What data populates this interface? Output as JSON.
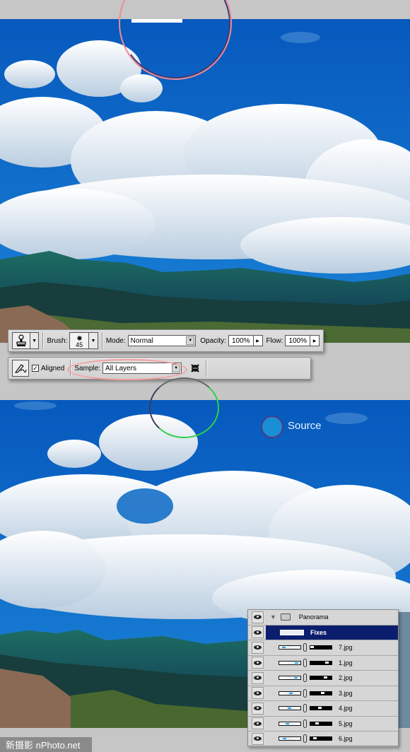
{
  "toolbar": {
    "tool_icon": "clone-stamp-icon",
    "brush_label": "Brush:",
    "brush_size": "45",
    "mode_label": "Mode:",
    "mode_value": "Normal",
    "opacity_label": "Opacity:",
    "opacity_value": "100%",
    "flow_label": "Flow:",
    "flow_value": "100%"
  },
  "toolbar2": {
    "aligned_label": "Aligned",
    "aligned_checked": "✓",
    "sample_label": "Sample:",
    "sample_value": "All Layers",
    "ignore_adjustment_icon": "ignore-adjustment-layers-icon"
  },
  "canvas": {
    "source_label": "Source",
    "colors": {
      "sky": "#0a63c4",
      "highlight_ellipse": "#f6a0a0",
      "source_marker": "#1a8fd6"
    }
  },
  "layers": {
    "group": "Panorama",
    "selected": "Fixes",
    "items": [
      {
        "name": "7.jpg",
        "thumb_pos": 0.15,
        "mask_pos": 0.05
      },
      {
        "name": "1.jpg",
        "thumb_pos": 0.85,
        "mask_pos": 0.85
      },
      {
        "name": "2.jpg",
        "thumb_pos": 0.8,
        "mask_pos": 0.75
      },
      {
        "name": "3.jpg",
        "thumb_pos": 0.55,
        "mask_pos": 0.6
      },
      {
        "name": "4.jpg",
        "thumb_pos": 0.45,
        "mask_pos": 0.45
      },
      {
        "name": "5.jpg",
        "thumb_pos": 0.35,
        "mask_pos": 0.3
      },
      {
        "name": "6.jpg",
        "thumb_pos": 0.2,
        "mask_pos": 0.2
      }
    ]
  },
  "watermark": "新摄影 nPhoto.net"
}
